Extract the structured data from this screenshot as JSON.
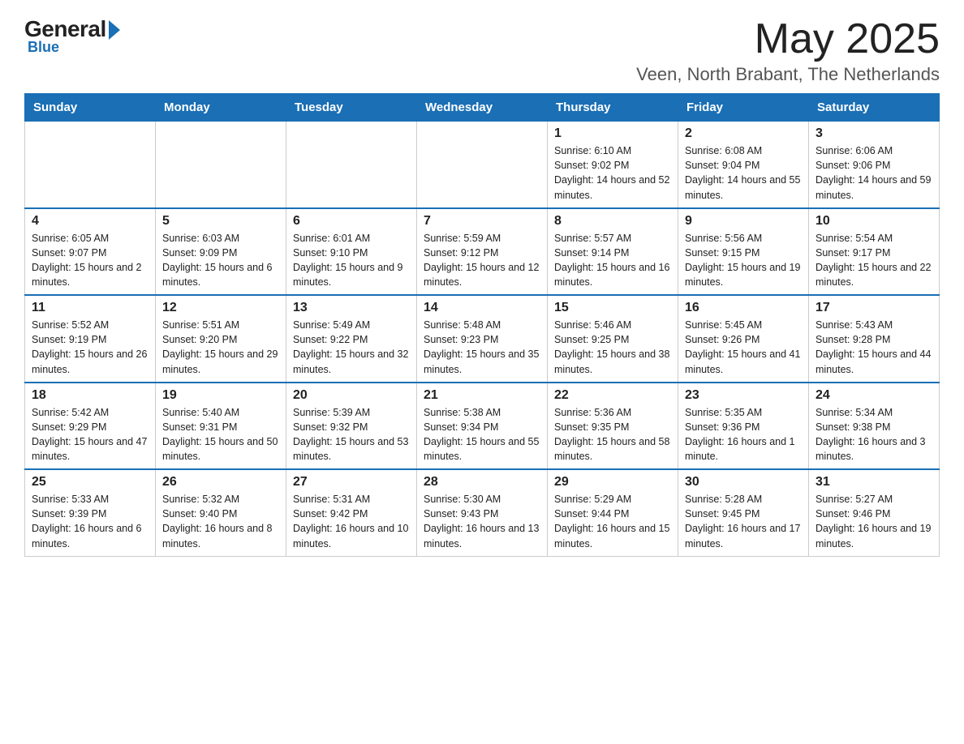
{
  "header": {
    "logo": {
      "general": "General",
      "blue": "Blue"
    },
    "month_year": "May 2025",
    "location": "Veen, North Brabant, The Netherlands"
  },
  "weekdays": [
    "Sunday",
    "Monday",
    "Tuesday",
    "Wednesday",
    "Thursday",
    "Friday",
    "Saturday"
  ],
  "weeks": [
    [
      {
        "day": "",
        "info": ""
      },
      {
        "day": "",
        "info": ""
      },
      {
        "day": "",
        "info": ""
      },
      {
        "day": "",
        "info": ""
      },
      {
        "day": "1",
        "info": "Sunrise: 6:10 AM\nSunset: 9:02 PM\nDaylight: 14 hours and 52 minutes."
      },
      {
        "day": "2",
        "info": "Sunrise: 6:08 AM\nSunset: 9:04 PM\nDaylight: 14 hours and 55 minutes."
      },
      {
        "day": "3",
        "info": "Sunrise: 6:06 AM\nSunset: 9:06 PM\nDaylight: 14 hours and 59 minutes."
      }
    ],
    [
      {
        "day": "4",
        "info": "Sunrise: 6:05 AM\nSunset: 9:07 PM\nDaylight: 15 hours and 2 minutes."
      },
      {
        "day": "5",
        "info": "Sunrise: 6:03 AM\nSunset: 9:09 PM\nDaylight: 15 hours and 6 minutes."
      },
      {
        "day": "6",
        "info": "Sunrise: 6:01 AM\nSunset: 9:10 PM\nDaylight: 15 hours and 9 minutes."
      },
      {
        "day": "7",
        "info": "Sunrise: 5:59 AM\nSunset: 9:12 PM\nDaylight: 15 hours and 12 minutes."
      },
      {
        "day": "8",
        "info": "Sunrise: 5:57 AM\nSunset: 9:14 PM\nDaylight: 15 hours and 16 minutes."
      },
      {
        "day": "9",
        "info": "Sunrise: 5:56 AM\nSunset: 9:15 PM\nDaylight: 15 hours and 19 minutes."
      },
      {
        "day": "10",
        "info": "Sunrise: 5:54 AM\nSunset: 9:17 PM\nDaylight: 15 hours and 22 minutes."
      }
    ],
    [
      {
        "day": "11",
        "info": "Sunrise: 5:52 AM\nSunset: 9:19 PM\nDaylight: 15 hours and 26 minutes."
      },
      {
        "day": "12",
        "info": "Sunrise: 5:51 AM\nSunset: 9:20 PM\nDaylight: 15 hours and 29 minutes."
      },
      {
        "day": "13",
        "info": "Sunrise: 5:49 AM\nSunset: 9:22 PM\nDaylight: 15 hours and 32 minutes."
      },
      {
        "day": "14",
        "info": "Sunrise: 5:48 AM\nSunset: 9:23 PM\nDaylight: 15 hours and 35 minutes."
      },
      {
        "day": "15",
        "info": "Sunrise: 5:46 AM\nSunset: 9:25 PM\nDaylight: 15 hours and 38 minutes."
      },
      {
        "day": "16",
        "info": "Sunrise: 5:45 AM\nSunset: 9:26 PM\nDaylight: 15 hours and 41 minutes."
      },
      {
        "day": "17",
        "info": "Sunrise: 5:43 AM\nSunset: 9:28 PM\nDaylight: 15 hours and 44 minutes."
      }
    ],
    [
      {
        "day": "18",
        "info": "Sunrise: 5:42 AM\nSunset: 9:29 PM\nDaylight: 15 hours and 47 minutes."
      },
      {
        "day": "19",
        "info": "Sunrise: 5:40 AM\nSunset: 9:31 PM\nDaylight: 15 hours and 50 minutes."
      },
      {
        "day": "20",
        "info": "Sunrise: 5:39 AM\nSunset: 9:32 PM\nDaylight: 15 hours and 53 minutes."
      },
      {
        "day": "21",
        "info": "Sunrise: 5:38 AM\nSunset: 9:34 PM\nDaylight: 15 hours and 55 minutes."
      },
      {
        "day": "22",
        "info": "Sunrise: 5:36 AM\nSunset: 9:35 PM\nDaylight: 15 hours and 58 minutes."
      },
      {
        "day": "23",
        "info": "Sunrise: 5:35 AM\nSunset: 9:36 PM\nDaylight: 16 hours and 1 minute."
      },
      {
        "day": "24",
        "info": "Sunrise: 5:34 AM\nSunset: 9:38 PM\nDaylight: 16 hours and 3 minutes."
      }
    ],
    [
      {
        "day": "25",
        "info": "Sunrise: 5:33 AM\nSunset: 9:39 PM\nDaylight: 16 hours and 6 minutes."
      },
      {
        "day": "26",
        "info": "Sunrise: 5:32 AM\nSunset: 9:40 PM\nDaylight: 16 hours and 8 minutes."
      },
      {
        "day": "27",
        "info": "Sunrise: 5:31 AM\nSunset: 9:42 PM\nDaylight: 16 hours and 10 minutes."
      },
      {
        "day": "28",
        "info": "Sunrise: 5:30 AM\nSunset: 9:43 PM\nDaylight: 16 hours and 13 minutes."
      },
      {
        "day": "29",
        "info": "Sunrise: 5:29 AM\nSunset: 9:44 PM\nDaylight: 16 hours and 15 minutes."
      },
      {
        "day": "30",
        "info": "Sunrise: 5:28 AM\nSunset: 9:45 PM\nDaylight: 16 hours and 17 minutes."
      },
      {
        "day": "31",
        "info": "Sunrise: 5:27 AM\nSunset: 9:46 PM\nDaylight: 16 hours and 19 minutes."
      }
    ]
  ]
}
